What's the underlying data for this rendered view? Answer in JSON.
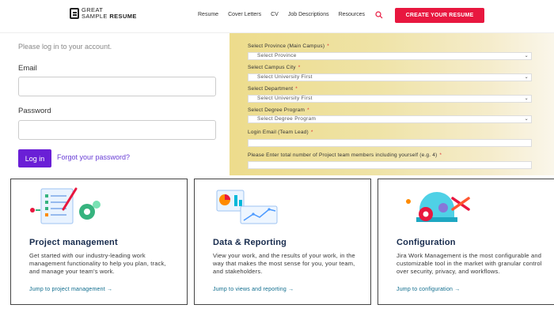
{
  "header": {
    "logo_line1": "GREAT",
    "logo_line2a": "SAMPLE",
    "logo_line2b": "RESUME",
    "nav": [
      "Resume",
      "Cover Letters",
      "CV",
      "Job Descriptions",
      "Resources"
    ],
    "cta_label": "CREATE YOUR RESUME",
    "accent_color": "#e8173f"
  },
  "login": {
    "intro": "Please log in to your account.",
    "email_label": "Email",
    "email_value": "",
    "password_label": "Password",
    "password_value": "",
    "login_button": "Log in",
    "forgot_link": "Forgot your password?",
    "button_color": "#6a1fd6"
  },
  "project_form": {
    "province_label": "Select Province (Main Campus)",
    "province_value": "Select Province",
    "city_label": "Select Campus City",
    "city_value": "Select University First",
    "department_label": "Select Department",
    "department_value": "Select University First",
    "degree_label": "Select Degree Program",
    "degree_value": "Select Degree Program",
    "email_label": "Login Email (Team Lead)",
    "members_label": "Please Enter total number of Project team members including yourself (e.g. 4)",
    "required_marker": "*"
  },
  "cards": [
    {
      "title": "Project management",
      "description": "Get started with our industry-leading work management functionality to help you plan, track, and manage your team's work.",
      "link": "Jump to project management →",
      "icon": "checklist-icon"
    },
    {
      "title": "Data & Reporting",
      "description": "View your work, and the results of your work, in the way that makes the most sense for you, your team, and stakeholders.",
      "link": "Jump to views and reporting →",
      "icon": "chart-report-icon"
    },
    {
      "title": "Configuration",
      "description": "Jira Work Management is the most configurable and customizable tool in the market with granular control over security, privacy, and workflows.",
      "link": "Jump to configuration →",
      "icon": "gears-tools-icon"
    }
  ]
}
